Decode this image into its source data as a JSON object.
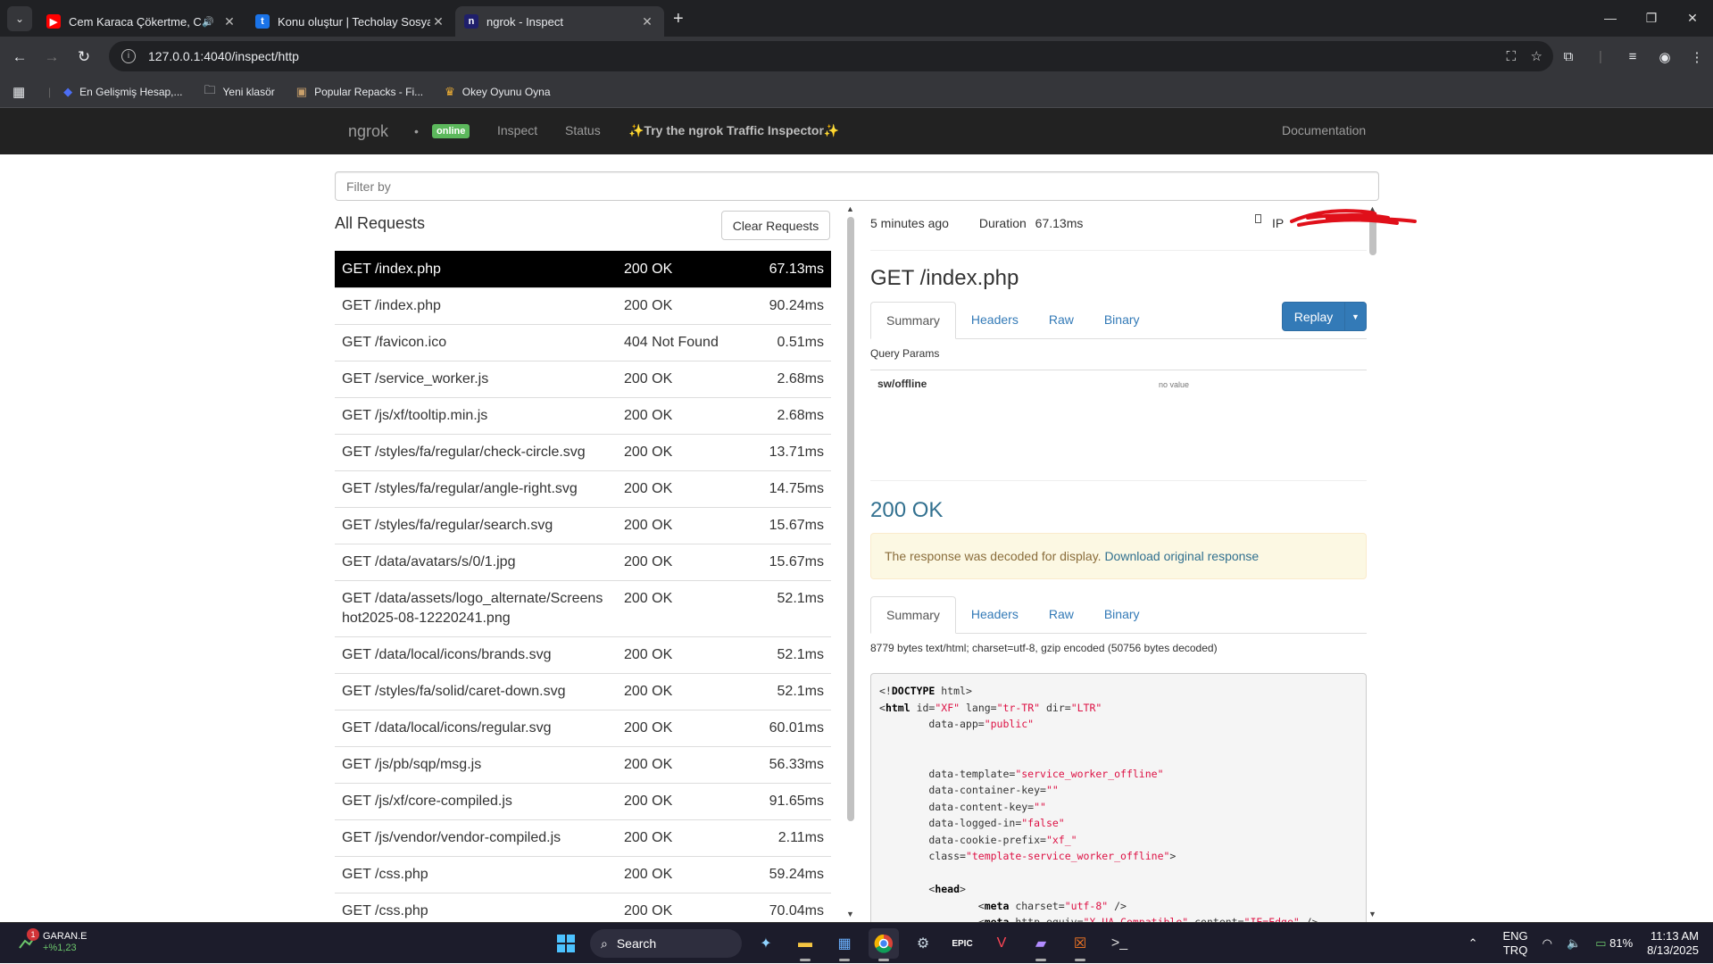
{
  "browser": {
    "tabs": [
      {
        "title": "Cem Karaca Çökertme, Cem",
        "favicon": "youtube-icon",
        "color": "#ff0000"
      },
      {
        "title": "Konu oluştur | Techolay Sosyal",
        "favicon": "techolay-icon",
        "color": "#1a73e8"
      },
      {
        "title": "ngrok - Inspect",
        "favicon": "ngrok-icon",
        "color": "#1f1f6b"
      }
    ],
    "url": "127.0.0.1:4040/inspect/http",
    "bookmarks": [
      {
        "label": "En Gelişmiş Hesap,...",
        "icon": "blue-drop-icon"
      },
      {
        "label": "Yeni klasör",
        "icon": "folder-icon"
      },
      {
        "label": "Popular Repacks - Fi...",
        "icon": "repack-icon"
      },
      {
        "label": "Okey Oyunu Oyna",
        "icon": "okey-icon"
      }
    ]
  },
  "ngrok_nav": {
    "brand": "ngrok",
    "status_badge": "online",
    "links": [
      "Inspect",
      "Status"
    ],
    "promo": "✨Try the ngrok Traffic Inspector✨",
    "docs": "Documentation"
  },
  "filter": {
    "placeholder": "Filter by"
  },
  "requests": {
    "title": "All Requests",
    "clear_label": "Clear Requests",
    "rows": [
      {
        "path": "GET /index.php",
        "status": "200 OK",
        "duration": "67.13ms",
        "selected": true
      },
      {
        "path": "GET /index.php",
        "status": "200 OK",
        "duration": "90.24ms"
      },
      {
        "path": "GET /favicon.ico",
        "status": "404 Not Found",
        "duration": "0.51ms"
      },
      {
        "path": "GET /service_worker.js",
        "status": "200 OK",
        "duration": "2.68ms"
      },
      {
        "path": "GET /js/xf/tooltip.min.js",
        "status": "200 OK",
        "duration": "2.68ms"
      },
      {
        "path": "GET /styles/fa/regular/check-circle.svg",
        "status": "200 OK",
        "duration": "13.71ms"
      },
      {
        "path": "GET /styles/fa/regular/angle-right.svg",
        "status": "200 OK",
        "duration": "14.75ms"
      },
      {
        "path": "GET /styles/fa/regular/search.svg",
        "status": "200 OK",
        "duration": "15.67ms"
      },
      {
        "path": "GET /data/avatars/s/0/1.jpg",
        "status": "200 OK",
        "duration": "15.67ms"
      },
      {
        "path": "GET /data/assets/logo_alternate/Screenshot2025-08-12220241.png",
        "status": "200 OK",
        "duration": "52.1ms"
      },
      {
        "path": "GET /data/local/icons/brands.svg",
        "status": "200 OK",
        "duration": "52.1ms"
      },
      {
        "path": "GET /styles/fa/solid/caret-down.svg",
        "status": "200 OK",
        "duration": "52.1ms"
      },
      {
        "path": "GET /data/local/icons/regular.svg",
        "status": "200 OK",
        "duration": "60.01ms"
      },
      {
        "path": "GET /js/pb/sqp/msg.js",
        "status": "200 OK",
        "duration": "56.33ms"
      },
      {
        "path": "GET /js/xf/core-compiled.js",
        "status": "200 OK",
        "duration": "91.65ms"
      },
      {
        "path": "GET /js/vendor/vendor-compiled.js",
        "status": "200 OK",
        "duration": "2.11ms"
      },
      {
        "path": "GET /css.php",
        "status": "200 OK",
        "duration": "59.24ms"
      },
      {
        "path": "GET /css.php",
        "status": "200 OK",
        "duration": "70.04ms"
      }
    ]
  },
  "detail": {
    "time_ago": "5 minutes ago",
    "duration_label": "Duration",
    "duration": "67.13ms",
    "ip_label": "IP",
    "request_title": "GET /index.php",
    "tabs": [
      "Summary",
      "Headers",
      "Raw",
      "Binary"
    ],
    "replay_label": "Replay",
    "query_params_label": "Query Params",
    "query_param": {
      "name": "sw/offline",
      "value": "no value"
    },
    "response_status": "200 OK",
    "alert_text": "The response was decoded for display.",
    "alert_link": "Download original response",
    "bytes_info": "8779 bytes text/html; charset=utf-8, gzip encoded (50756 bytes decoded)",
    "code_lines": [
      "<!DOCTYPE html>",
      "<html id=\"XF\" lang=\"tr-TR\" dir=\"LTR\"",
      "        data-app=\"public\"",
      "",
      "",
      "        data-template=\"service_worker_offline\"",
      "        data-container-key=\"\"",
      "        data-content-key=\"\"",
      "        data-logged-in=\"false\"",
      "        data-cookie-prefix=\"xf_\"",
      "        class=\"template-service_worker_offline\">",
      "",
      "        <head>",
      "                <meta charset=\"utf-8\" />",
      "                <meta http-equiv=\"X-UA-Compatible\" content=\"IE=Edge\" />"
    ]
  },
  "taskbar": {
    "stock_name": "GARAN.E",
    "stock_change": "+%1,23",
    "stock_badge": "1",
    "search_label": "Search",
    "lang_top": "ENG",
    "lang_bottom": "TRQ",
    "battery": "81%",
    "time": "11:13 AM",
    "date": "8/13/2025"
  }
}
